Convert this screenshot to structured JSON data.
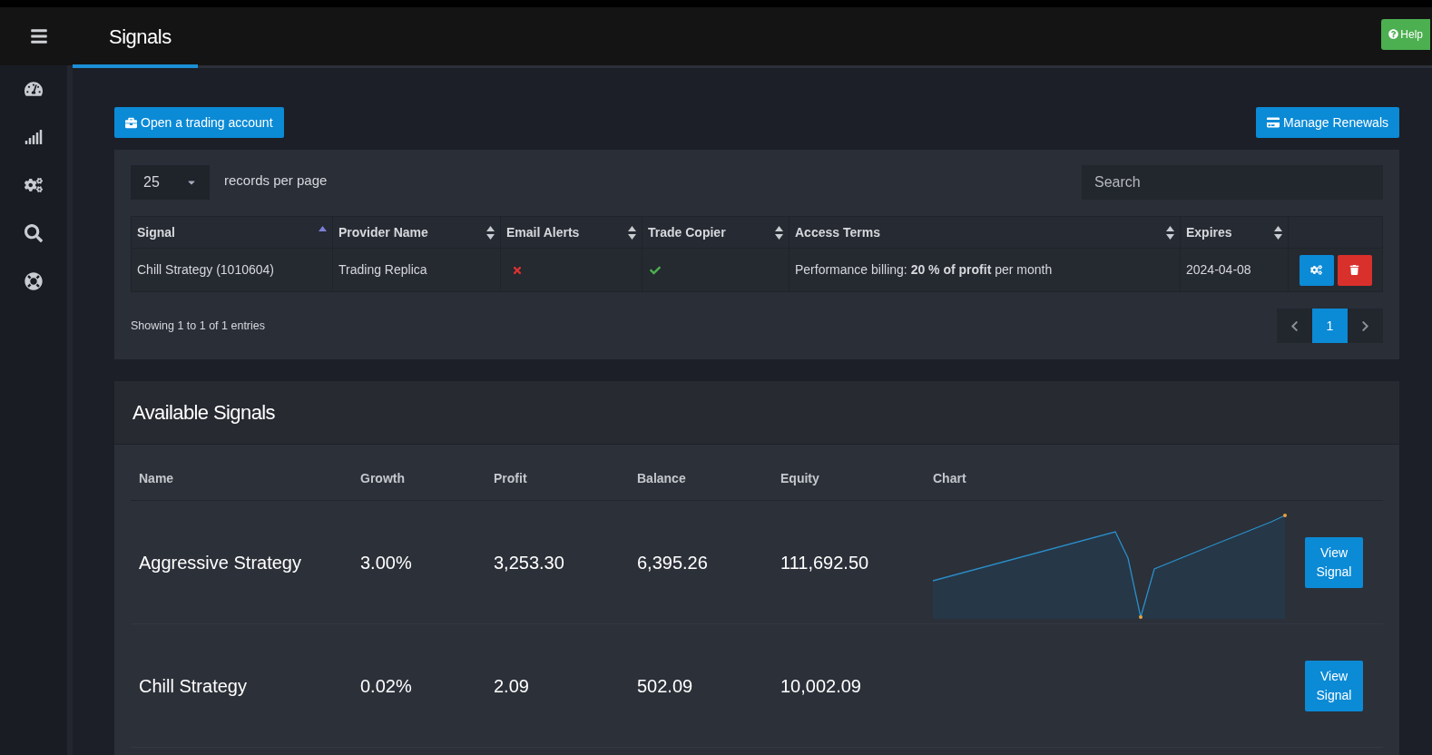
{
  "header": {
    "title": "Signals",
    "help": "Help"
  },
  "sidebar": {
    "items": [
      {
        "kind": "dashboard",
        "selected": false
      },
      {
        "kind": "signals",
        "selected": false
      },
      {
        "kind": "settings",
        "selected": false
      },
      {
        "kind": "search",
        "selected": false
      },
      {
        "kind": "support",
        "selected": false
      }
    ]
  },
  "actions": {
    "open_account": "Open a trading account",
    "manage_renewals": "Manage Renewals"
  },
  "subscriptions": {
    "page_size": "25",
    "page_size_label": "records per page",
    "search": {
      "placeholder": "Search"
    },
    "columns": [
      {
        "label": "Signal",
        "sorted": true
      },
      {
        "label": "Provider Name",
        "sorted": false
      },
      {
        "label": "Email Alerts",
        "sorted": false
      },
      {
        "label": "Trade Copier",
        "sorted": false
      },
      {
        "label": "Access Terms",
        "sorted": false
      },
      {
        "label": "Expires",
        "sorted": false
      }
    ],
    "rows": [
      {
        "signal": "Chill Strategy (1010604)",
        "provider": "Trading Replica",
        "email_alerts": false,
        "trade_copier": true,
        "access_terms": "Performance billing: **20 % of profit** per month",
        "expires": "2024-04-08"
      }
    ],
    "info": "Showing 1 to 1 of 1 entries",
    "pages": [
      {
        "label": "1",
        "selected": true
      }
    ]
  },
  "available": {
    "title": "Available Signals",
    "columns": [
      "Name",
      "Growth",
      "Profit",
      "Balance",
      "Equity",
      "Chart"
    ],
    "rows": [
      {
        "name": "Aggressive Strategy",
        "growth": "3.00%",
        "profit": "3,253.30",
        "balance": "6,395.26",
        "equity": "111,692.50",
        "sparkline": true,
        "button": "View Signal"
      },
      {
        "name": "Chill Strategy",
        "growth": "0.02%",
        "profit": "2.09",
        "balance": "502.09",
        "equity": "10,002.09",
        "sparkline": false,
        "button": "View Signal"
      }
    ]
  }
}
